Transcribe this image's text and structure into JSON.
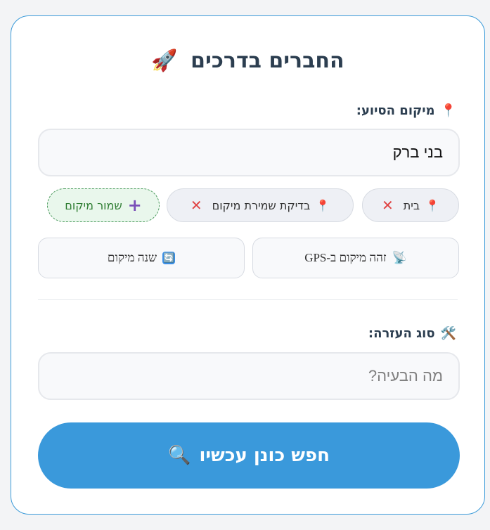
{
  "header": {
    "title": "החברים בדרכים",
    "title_icon": "rocket-icon",
    "title_emoji": "🚀"
  },
  "location": {
    "label": "מיקום הסיוע:",
    "label_icon": "📍",
    "value": "בני ברק",
    "chips": [
      {
        "label": "בית",
        "pin": "📍",
        "remove": "✕"
      },
      {
        "label": "בדיקת שמירת מיקום",
        "pin": "📍",
        "remove": "✕"
      }
    ],
    "save_label": "שמור מיקום",
    "save_icon": "+"
  },
  "actions": {
    "gps_label": "זהה מיקום ב-GPS",
    "gps_icon": "📡",
    "change_label": "שנה מיקום",
    "change_icon": "🔄"
  },
  "help": {
    "label": "סוג העזרה:",
    "label_icon": "🛠️",
    "placeholder": "מה הבעיה?"
  },
  "search": {
    "label": "חפש כונן עכשיו",
    "icon": "🔍"
  },
  "colors": {
    "accent": "#3a99db",
    "border": "#3a9ad9",
    "title": "#2c3e50",
    "save_green": "#2e7d32",
    "remove_red": "#e04545"
  }
}
